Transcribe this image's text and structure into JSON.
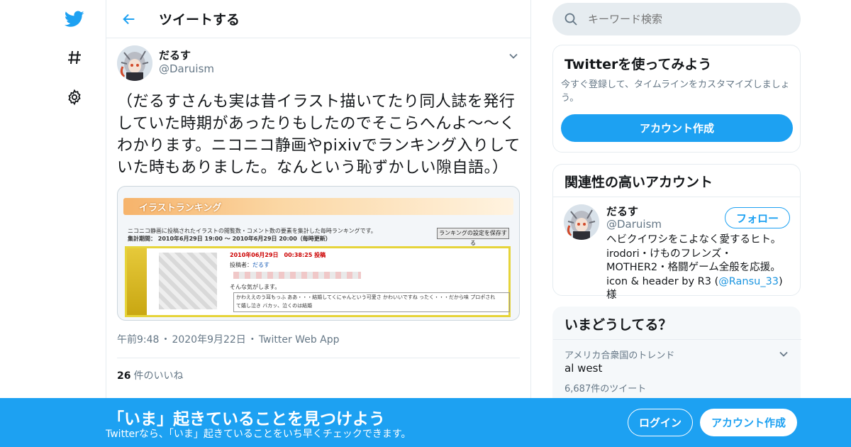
{
  "colors": {
    "accent": "#1da1f2",
    "text": "#14171a",
    "muted": "#657786",
    "border": "#e6ecf0"
  },
  "nav": {
    "items": [
      {
        "icon": "twitter-bird-icon"
      },
      {
        "icon": "hashtag-icon"
      },
      {
        "icon": "gear-icon"
      }
    ]
  },
  "header": {
    "title": "ツイートする",
    "back_icon": "back-arrow-icon"
  },
  "tweet": {
    "author_name": "だるす",
    "author_handle": "@Daruism",
    "text": "（だるすさんも実は昔イラスト描いてたり同人誌を発行していた時期があったりもしたのでそこらへんよ～～くわかります。ニコニコ静画やpixivでランキング入りしていた時もありました。なんという恥ずかしい隙自語。）",
    "media": {
      "banner": "イラストランキング",
      "desc": "ニコニコ静画に投稿されたイラストの閲覧数・コメント数の要素を集計した毎時ランキングです。",
      "period": "集計期間： 2010年6月29日 19:00 ～ 2010年6月29日 20:00（毎時更新）",
      "button": "ランキングの設定を保存する",
      "rank_date": "2010年06月29日　00:38:25 投稿",
      "poster_label": "投稿者：",
      "poster": "だるす",
      "comment": "そんな気がします。",
      "comments_line1": "かわええのう耳もっふ ああ・・・結婚してくにゃんという可愛さ かわいいですね ったく・・・だから味 プロポされ",
      "comments_line2": "て嬉し泣き バカッ、泣くのは結婚"
    },
    "time": "午前9:48",
    "date": "2020年9月22日",
    "source": "Twitter Web App",
    "likes_count": "26",
    "likes_label": "件のいいね"
  },
  "search": {
    "placeholder": "キーワード検索"
  },
  "try_card": {
    "title": "Twitterを使ってみよう",
    "desc": "今すぐ登録して、タイムラインをカスタマイズしましょう。",
    "button": "アカウント作成"
  },
  "related_card": {
    "title": "関連性の高いアカウント",
    "name": "だるす",
    "handle": "@Daruism",
    "follow_button": "フォロー",
    "bio_line1": "ヘビクイワシをこよなく愛するヒト。",
    "bio_line2": "irodori・けものフレンズ・",
    "bio_line3": "MOTHER2・格闘ゲーム全般を応援。",
    "bio_line4_pre": "icon & header by R3 (",
    "bio_link": "@Ransu_33",
    "bio_line4_post": ") 様"
  },
  "trends_card": {
    "title": "いまどうしてる？",
    "context": "アメリカ合衆国のトレンド",
    "name": "al west",
    "count": "6,687件のツイート"
  },
  "bottom_bar": {
    "title": "「いま」起きていることを見つけよう",
    "subtitle": "Twitterなら、「いま」起きていることをいち早くチェックできます。",
    "login": "ログイン",
    "signup": "アカウント作成"
  }
}
